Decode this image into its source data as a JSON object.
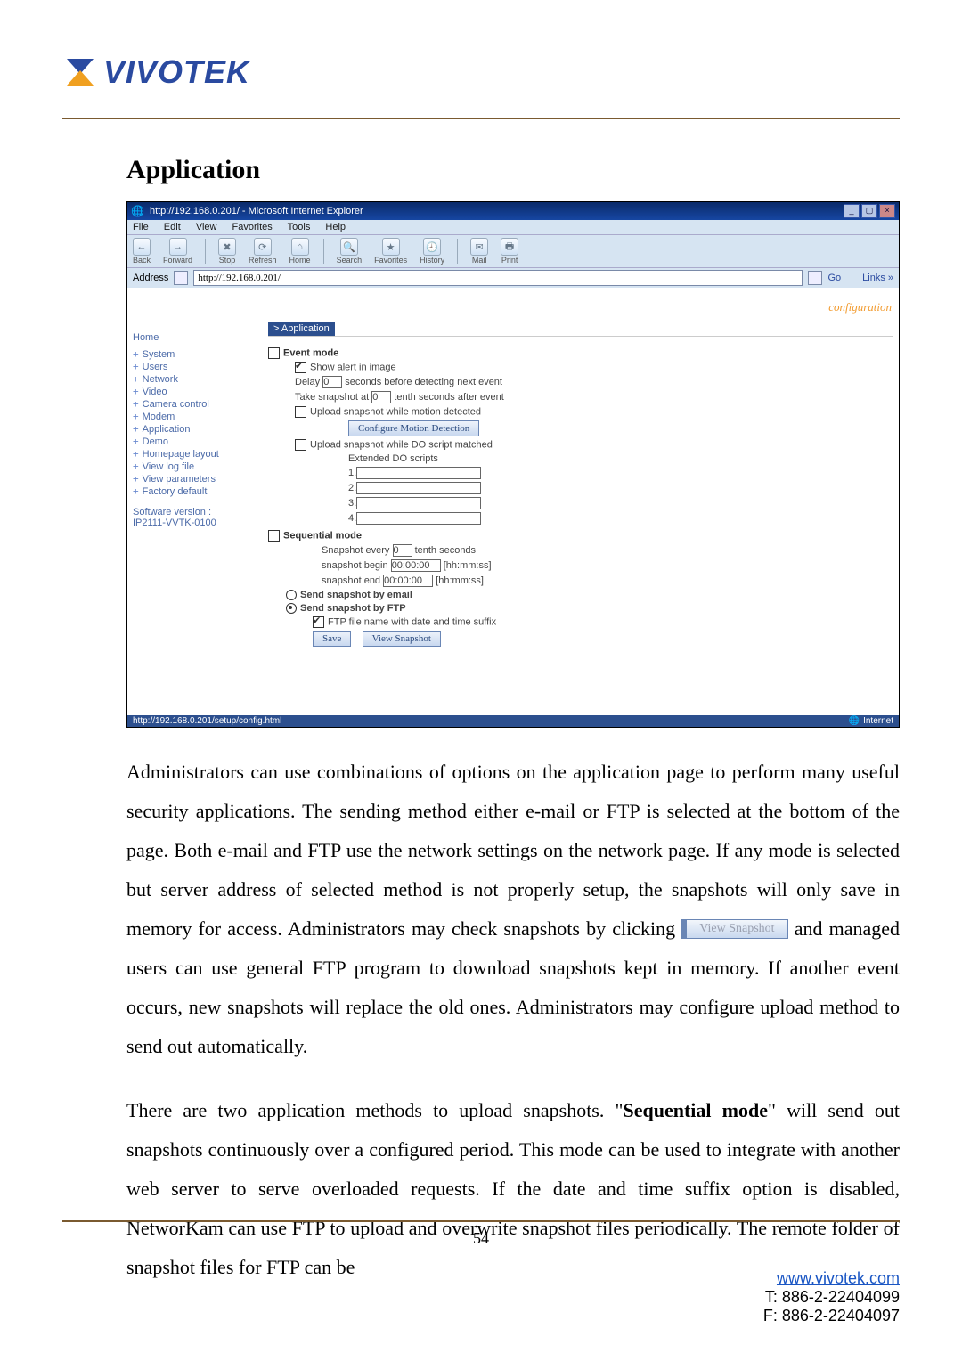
{
  "logo_text": "VIVOTEK",
  "section_title": "Application",
  "browser": {
    "title": "http://192.168.0.201/ - Microsoft Internet Explorer",
    "menus": [
      "File",
      "Edit",
      "View",
      "Favorites",
      "Tools",
      "Help"
    ],
    "tool_buttons": [
      "Back",
      "Forward",
      "Stop",
      "Refresh",
      "Home",
      "Search",
      "Favorites",
      "History",
      "Mail",
      "Print"
    ],
    "address_label": "Address",
    "address_value": "http://192.168.0.201/",
    "go_label": "Go",
    "links_label": "Links »",
    "config_label": "configuration",
    "breadcrumb": "> Application",
    "sidebar_home": "Home",
    "sidebar_items": [
      "System",
      "Users",
      "Network",
      "Video",
      "Camera control",
      "Modem",
      "Application",
      "Demo",
      "Homepage layout",
      "View log file",
      "View parameters",
      "Factory default"
    ],
    "sw_version_label": "Software version :",
    "sw_version_value": "IP2111-VVTK-0100",
    "event_mode_label": "Event mode",
    "show_alert": "Show alert in image",
    "delay_prefix": "Delay",
    "delay_value": "0",
    "delay_suffix": "seconds before detecting next event",
    "snap_prefix": "Take snapshot at",
    "snap_value": "0",
    "snap_suffix": "tenth seconds after event",
    "upload_motion": "Upload snapshot while motion detected",
    "config_motion_btn": "Configure Motion Detection",
    "upload_do": "Upload snapshot while DO script matched",
    "extended_do": "Extended DO scripts",
    "script_nums": [
      "1.",
      "2.",
      "3.",
      "4."
    ],
    "sequential_label": "Sequential mode",
    "seq_every_prefix": "Snapshot every",
    "seq_every_value": "0",
    "seq_every_suffix": "tenth seconds",
    "seq_begin_prefix": "snapshot begin",
    "seq_begin_value": "00:00:00",
    "seq_hint": "[hh:mm:ss]",
    "seq_end_prefix": "snapshot end",
    "seq_end_value": "00:00:00",
    "send_email": "Send snapshot by email",
    "send_ftp": "Send snapshot by FTP",
    "ftp_suffix": "FTP file name with date and time suffix",
    "save_btn": "Save",
    "view_snapshot_btn": "View Snapshot",
    "status_text": "http://192.168.0.201/setup/config.html",
    "status_net": "Internet"
  },
  "inline_button": "View Snapshot",
  "para1a": "Administrators can use combinations of options on the application page to perform many useful security applications. The sending method either e-mail or FTP is selected at the bottom of the page. Both e-mail and FTP use the network settings on the network page. If any mode is selected but server address of selected method is not properly setup, the snapshots will only save in memory for access. Administrators may check snapshots by clicking ",
  "para1b": " and managed users can use general FTP program to download snapshots kept in memory. If another event occurs, new snapshots will replace the old ones. Administrators may configure upload method to send out automatically.",
  "para2a": "There are two application methods to upload snapshots. \"",
  "para2_bold": "Sequential mode",
  "para2b": "\" will send out snapshots continuously over a configured period. This mode can be used to integrate with another web server to serve overloaded requests. If the date and time suffix option is disabled, NetworKam can use FTP to upload and overwrite snapshot files periodically. The remote folder of snapshot files for FTP can be",
  "page_number": "54",
  "footer_link": "www.vivotek.com",
  "footer_tel": "T: 886-2-22404099",
  "footer_fax": "F: 886-2-22404097"
}
